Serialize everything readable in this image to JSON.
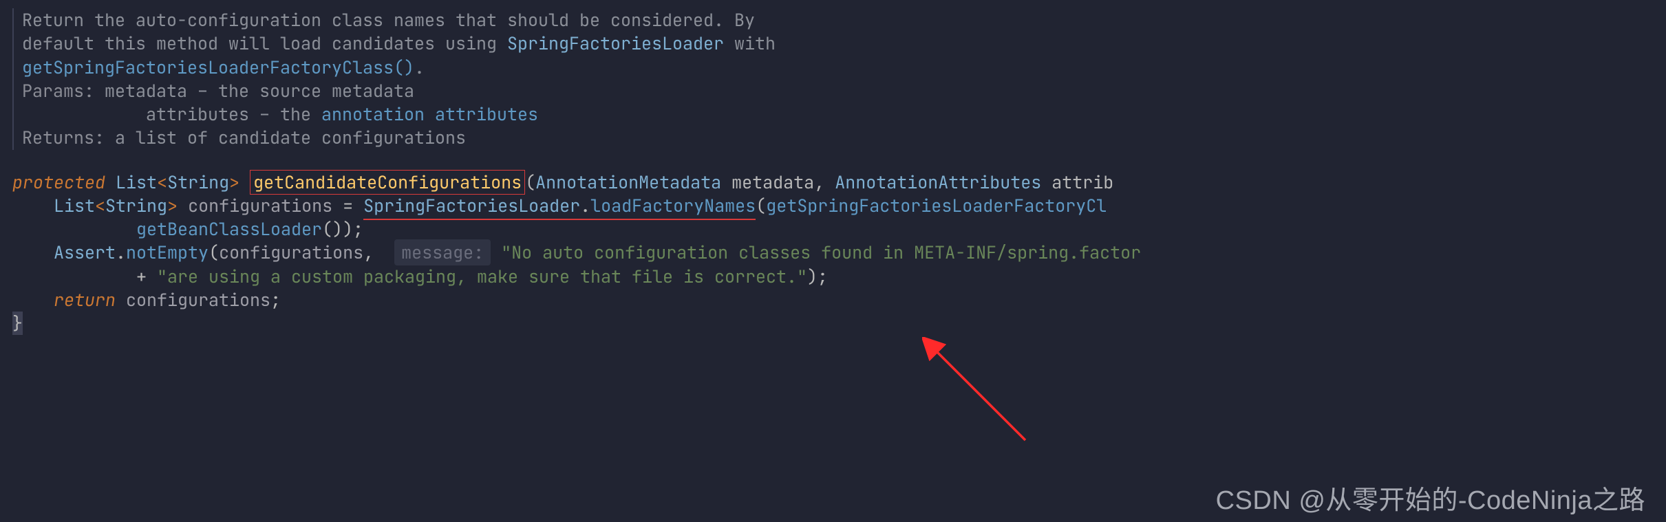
{
  "doc": {
    "line1a": "Return the auto-configuration class names that should be considered. By",
    "line2a": "default this method will load candidates using ",
    "type1": "SpringFactoriesLoader",
    "line2b": " with",
    "method1": "getSpringFactoriesLoaderFactoryClass()",
    "dot": ".",
    "params_label": "Params:",
    "param1": " metadata – the source metadata",
    "param2_pad": "            ",
    "param2a": "attributes – the ",
    "param2_hl": "annotation attributes",
    "returns_label": "Returns:",
    "returns_text": " a list of candidate configurations"
  },
  "code": {
    "protected": "protected",
    "list": "List",
    "string": "String",
    "lt": "<",
    "gt": ">",
    "method_def": "getCandidateConfigurations",
    "open": "(",
    "close": ")",
    "annMeta": "AnnotationMetadata",
    "p_metadata": "metadata",
    "comma": ", ",
    "annAttr": "AnnotationAttributes",
    "p_attrib": "attrib",
    "indent1": "    ",
    "indent2": "            ",
    "configurations": "configurations",
    "eq": " = ",
    "sfl": "SpringFactoriesLoader",
    "dot": ".",
    "loadFactoryNames": "loadFactoryNames",
    "getSFLFC": "getSpringFactoriesLoaderFactoryCl",
    "getBeanClassLoader": "getBeanClassLoader",
    "empty_args": "()",
    "close_semi": ");",
    "assert": "Assert",
    "notEmpty": "notEmpty",
    "hint_message": "message:",
    "str_no_auto": "\"No auto configuration classes found in META-INF/spring.factor",
    "plus": "+ ",
    "str_custom": "\"are using a custom packaging, make sure that file is correct.\"",
    "return": "return",
    "semi": ";",
    "end_brace": "}"
  },
  "watermark": "CSDN @从零开始的-CodeNinja之路"
}
